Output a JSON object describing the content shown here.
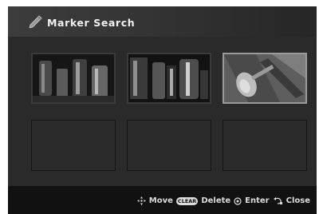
{
  "title": "Marker Search",
  "thumbnails": [
    {
      "slot": 1,
      "state": "image",
      "selected": false
    },
    {
      "slot": 2,
      "state": "image",
      "selected": false
    },
    {
      "slot": 3,
      "state": "image",
      "selected": true
    },
    {
      "slot": 4,
      "state": "empty",
      "selected": false
    },
    {
      "slot": 5,
      "state": "empty",
      "selected": false
    },
    {
      "slot": 6,
      "state": "empty",
      "selected": false
    }
  ],
  "hints": {
    "move_icon": "dpad-icon",
    "move_label": "Move",
    "clear_button": "CLEAR",
    "delete_label": "Delete",
    "enter_icon": "enter-icon",
    "enter_label": "Enter",
    "close_icon": "return-icon",
    "close_label": "Close"
  },
  "colors": {
    "background": "#2a2a2a",
    "title_bar": "#3a3a3a",
    "bottom_bar": "#111111",
    "selected_border": "#9a9a9a"
  }
}
